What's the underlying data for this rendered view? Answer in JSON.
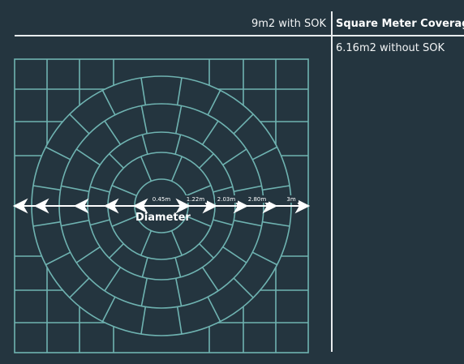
{
  "coverage": {
    "with_sok": "9m2 with SOK",
    "title": "Square Meter Coverage",
    "without_sok": "6.16m2 without SOK"
  },
  "diagram": {
    "diameter_label": "Diameter",
    "dimensions": [
      "0.45m",
      "1.22m",
      "2.03m",
      "2.80m",
      "3m"
    ],
    "colors": {
      "background": "#24353f",
      "grid": "#6fb3b1",
      "arrows": "#ffffff"
    }
  }
}
